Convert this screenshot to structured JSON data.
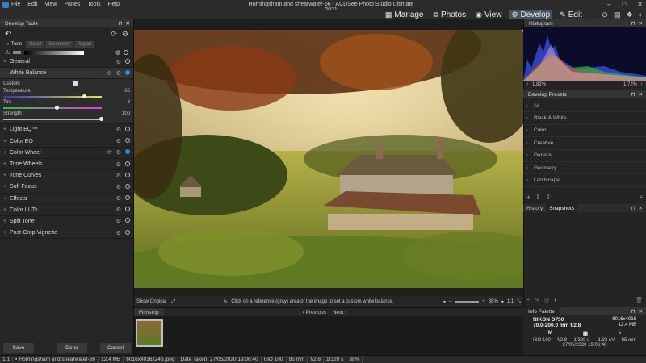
{
  "window": {
    "title": "Horningsham and shearwater-66 - ACDSee Photo Studio Ultimate 2021",
    "menu": [
      "File",
      "Edit",
      "View",
      "Panes",
      "Tools",
      "Help"
    ]
  },
  "modes": [
    {
      "label": "Manage",
      "icon": "grid-icon"
    },
    {
      "label": "Photos",
      "icon": "photos-icon"
    },
    {
      "label": "View",
      "icon": "eye-icon"
    },
    {
      "label": "Develop",
      "icon": "develop-icon",
      "active": true
    },
    {
      "label": "Edit",
      "icon": "edit-icon"
    }
  ],
  "left_panel": {
    "title": "Develop Tools",
    "tabs": [
      "Tune",
      "Detail",
      "Geometry",
      "Repair"
    ],
    "active_tab": "Tune",
    "general": "General",
    "white_balance": {
      "label": "White Balance",
      "preset": "Custom",
      "temperature_label": "Temperature",
      "temperature_value": "66",
      "temperature_fraction": 0.83,
      "tint_label": "Tint",
      "tint_value": "8",
      "tint_fraction": 0.55,
      "strength_label": "Strength",
      "strength_value": "100",
      "strength_fraction": 1.0
    },
    "tools": [
      "Light EQ™",
      "Color EQ",
      "Color Wheel",
      "Tone Wheels",
      "Tone Curves",
      "Soft Focus",
      "Effects",
      "Color LUTs",
      "Split Tone",
      "Post-Crop Vignette"
    ],
    "buttons": {
      "save": "Save",
      "done": "Done",
      "cancel": "Cancel"
    }
  },
  "main": {
    "show_original": "Show Original",
    "hint": "Click on a reference (gray) area of the image to set a custom white balance.",
    "zoom": "38%",
    "page_fraction": "1:1"
  },
  "filmstrip": {
    "title": "Filmstrip",
    "previous": "Previous",
    "next": "Next"
  },
  "right_panel": {
    "histogram_title": "Histogram",
    "hist_left": "1.82%",
    "hist_right": "1.72%",
    "presets_title": "Develop Presets",
    "presets": [
      "All",
      "Black & White",
      "Color",
      "Creative",
      "General",
      "Geometry",
      "Landscape"
    ],
    "tab_history": "History",
    "tab_snapshots": "Snapshots",
    "info_title": "Info Palette",
    "camera": "NIKON D750",
    "lens": "70.0-200.0 mm f/2.8",
    "dimensions": "6016x4016",
    "filesize": "12.4 MB",
    "mode": "M",
    "iso": "ISO 100",
    "aperture": "f/2.8",
    "shutter": "1/320 s",
    "ev": "-1.33 eV",
    "focal": "95 mm",
    "datetime": "27/05/2020 19:06:40"
  },
  "statusbar": {
    "index": "1/1",
    "filename": "Horningsham and shearwater-66",
    "size": "12.4 MB",
    "format": "6016x4016x24b.jpeg",
    "date_taken": "Date Taken: 27/05/2020 19:06:40",
    "iso": "ISO 100",
    "focal": "95 mm",
    "aperture": "f/2.8",
    "shutter": "1/320 s",
    "zoom": "38%"
  }
}
